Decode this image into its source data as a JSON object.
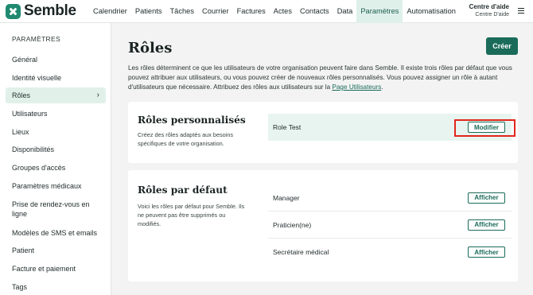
{
  "app": {
    "name": "Semble"
  },
  "nav": {
    "items": [
      "Calendrier",
      "Patients",
      "Tâches",
      "Courrier",
      "Factures",
      "Actes",
      "Contacts",
      "Data",
      "Paramètres",
      "Automatisation"
    ],
    "active": "Paramètres"
  },
  "help": {
    "title": "Centre d'aide",
    "subtitle": "Centre D'aide"
  },
  "sidebar": {
    "title": "PARAMÈTRES",
    "items": [
      "Général",
      "Identité visuelle",
      "Rôles",
      "Utilisateurs",
      "Lieux",
      "Disponibilités",
      "Groupes d'accès",
      "Paramètres médicaux",
      "Prise de rendez-vous en ligne",
      "Modèles de SMS et emails",
      "Patient",
      "Facture et paiement",
      "Tags"
    ],
    "active": "Rôles",
    "chevron": "›"
  },
  "main": {
    "title": "Rôles",
    "create_label": "Créer",
    "intro_text": "Les rôles déterminent ce que les utilisateurs de votre organisation peuvent faire dans Semble. Il existe trois rôles par défaut que vous pouvez attribuer aux utilisateurs, ou vous pouvez créer de nouveaux rôles personnalisés. Vous pouvez assigner un rôle à autant d'utilisateurs que nécessaire. Attribuez des rôles aux utilisateurs sur la ",
    "intro_link": "Page Utilisateurs",
    "intro_end": "."
  },
  "custom_roles": {
    "title": "Rôles personnalisés",
    "description": "Créez des rôles adaptés aux besoins spécifiques de votre organisation.",
    "roles": [
      {
        "name": "Role Test",
        "action": "Modifier"
      }
    ]
  },
  "default_roles": {
    "title": "Rôles par défaut",
    "description": "Voici les rôles par défaut pour Semble. Ils ne peuvent pas être supprimés ou modifiés.",
    "roles": [
      {
        "name": "Manager",
        "action": "Afficher"
      },
      {
        "name": "Praticien(ne)",
        "action": "Afficher"
      },
      {
        "name": "Secrétaire médical",
        "action": "Afficher"
      }
    ]
  },
  "colors": {
    "brand": "#1a6b5a",
    "highlight_row": "#e8f4ef",
    "annotation": "#e1261c"
  }
}
